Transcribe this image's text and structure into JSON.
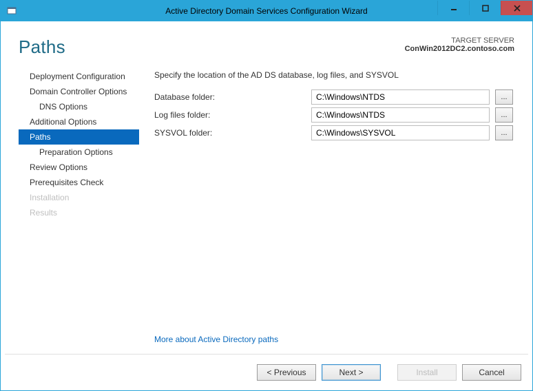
{
  "window": {
    "title": "Active Directory Domain Services Configuration Wizard"
  },
  "header": {
    "page_title": "Paths",
    "target_label": "TARGET SERVER",
    "target_name": "ConWin2012DC2.contoso.com"
  },
  "nav": {
    "items": [
      {
        "label": "Deployment Configuration",
        "indent": 0,
        "selected": false,
        "disabled": false
      },
      {
        "label": "Domain Controller Options",
        "indent": 0,
        "selected": false,
        "disabled": false
      },
      {
        "label": "DNS Options",
        "indent": 1,
        "selected": false,
        "disabled": false
      },
      {
        "label": "Additional Options",
        "indent": 0,
        "selected": false,
        "disabled": false
      },
      {
        "label": "Paths",
        "indent": 0,
        "selected": true,
        "disabled": false
      },
      {
        "label": "Preparation Options",
        "indent": 1,
        "selected": false,
        "disabled": false
      },
      {
        "label": "Review Options",
        "indent": 0,
        "selected": false,
        "disabled": false
      },
      {
        "label": "Prerequisites Check",
        "indent": 0,
        "selected": false,
        "disabled": false
      },
      {
        "label": "Installation",
        "indent": 0,
        "selected": false,
        "disabled": true
      },
      {
        "label": "Results",
        "indent": 0,
        "selected": false,
        "disabled": true
      }
    ]
  },
  "pane": {
    "instruction": "Specify the location of the AD DS database, log files, and SYSVOL",
    "fields": {
      "database": {
        "label": "Database folder:",
        "value": "C:\\Windows\\NTDS"
      },
      "logfiles": {
        "label": "Log files folder:",
        "value": "C:\\Windows\\NTDS"
      },
      "sysvol": {
        "label": "SYSVOL folder:",
        "value": "C:\\Windows\\SYSVOL"
      }
    },
    "browse_label": "...",
    "link_text": "More about Active Directory paths"
  },
  "footer": {
    "previous": "< Previous",
    "next": "Next >",
    "install": "Install",
    "cancel": "Cancel"
  }
}
